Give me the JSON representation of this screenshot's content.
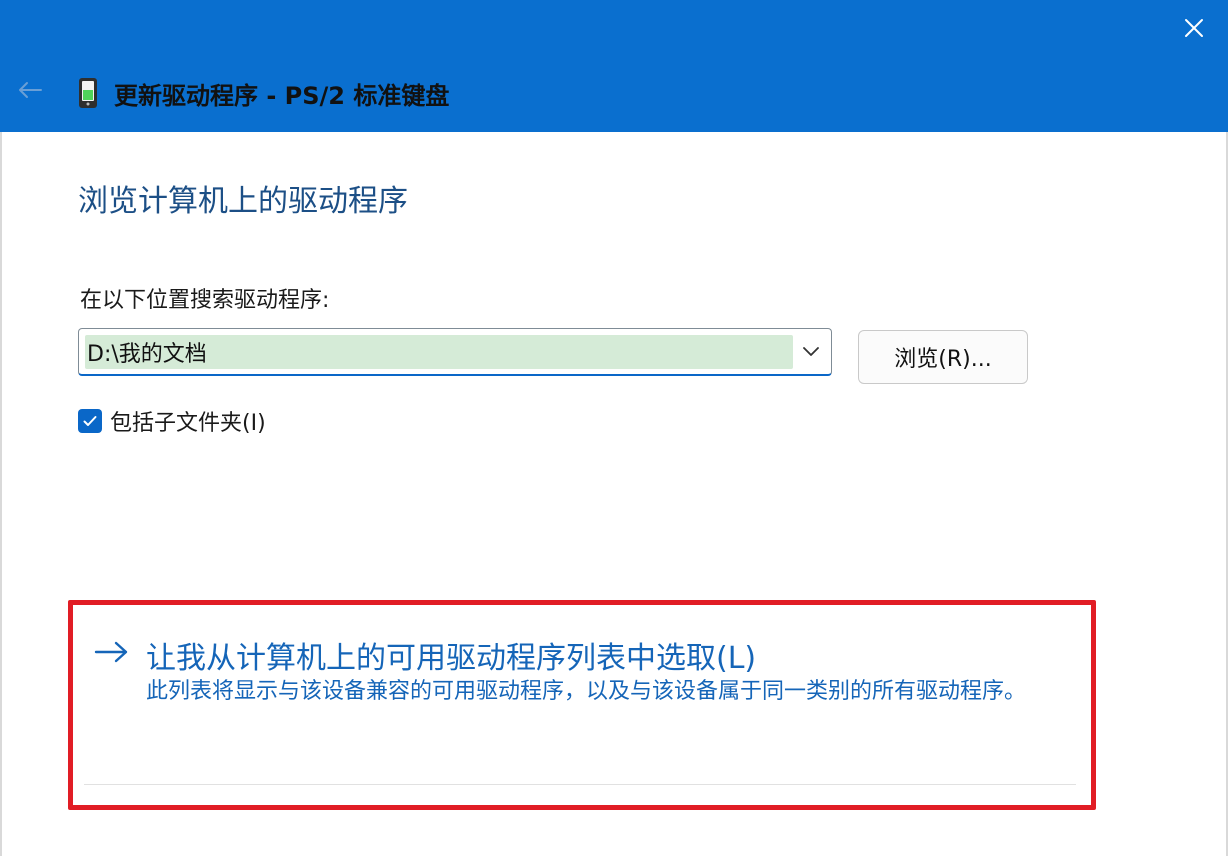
{
  "window": {
    "title": "更新驱动程序 - PS/2 标准键盘",
    "back_icon": "back-arrow-icon",
    "device_icon": "keyboard-device-icon",
    "close_icon": "close-icon"
  },
  "page": {
    "title": "浏览计算机上的驱动程序",
    "search_label": "在以下位置搜索驱动程序:",
    "path_value": "D:\\我的文档",
    "browse_button": "浏览(R)...",
    "include_subfolders_label": "包括子文件夹(I)",
    "include_subfolders_checked": true
  },
  "option": {
    "title": "让我从计算机上的可用驱动程序列表中选取(L)",
    "description": "此列表将显示与该设备兼容的可用驱动程序，以及与该设备属于同一类别的所有驱动程序。",
    "icon": "arrow-right-icon"
  },
  "colors": {
    "titlebar": "#0a6fcf",
    "accent": "#0a67c8",
    "link": "#1565b8",
    "highlight_border": "#e11d25",
    "path_highlight": "#d5ebd7"
  }
}
